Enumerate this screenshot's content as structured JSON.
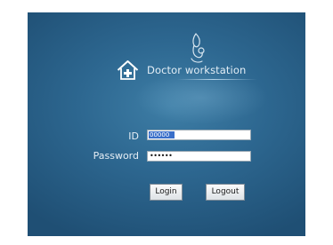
{
  "header": {
    "title": "Doctor workstation",
    "logo_icon": "stethoscope-icon",
    "home_icon": "hospital-home-icon"
  },
  "form": {
    "id_label": "ID",
    "id_value": "00000",
    "password_label": "Password",
    "password_value": "••••••"
  },
  "buttons": {
    "login_label": "Login",
    "logout_label": "Logout"
  },
  "colors": {
    "panel_center": "#3e7ea6",
    "panel_edge": "#1f4f74",
    "text": "#e6eef5",
    "selection": "#3a6fc9"
  }
}
